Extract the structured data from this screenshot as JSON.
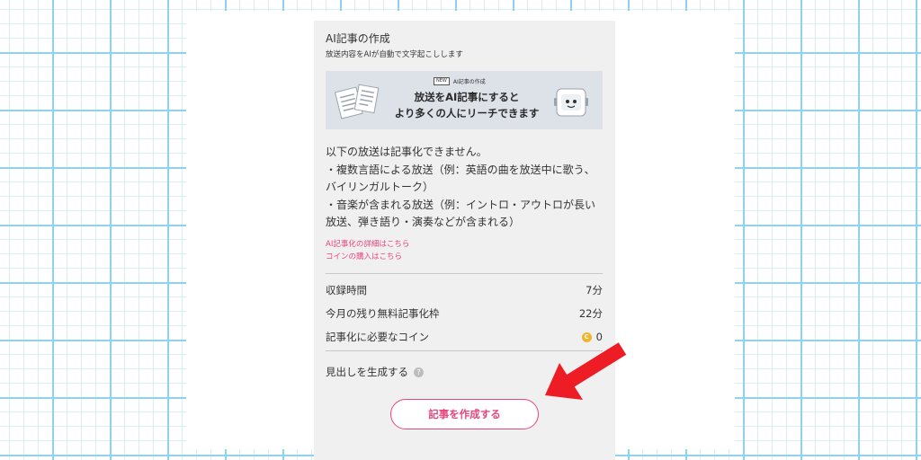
{
  "panel": {
    "title": "AI記事の作成",
    "subtitle": "放送内容をAIが自動で文字起こしします"
  },
  "banner": {
    "tag_new": "NEW",
    "tag_label": "AI記事の作成",
    "line1": "放送をAI記事にすると",
    "line2": "より多くの人にリーチできます"
  },
  "notice": {
    "lines": [
      "以下の放送は記事化できません。",
      "・複数言語による放送（例：英語の曲を放送中に歌う、",
      "バイリンガルトーク）",
      "・音楽が含まれる放送（例：イントロ・アウトロが長い",
      "放送、弾き語り・演奏などが含まれる）"
    ]
  },
  "links": {
    "details": "AI記事化の詳細はこちら",
    "buy_coins": "コインの購入はこちら"
  },
  "stats": {
    "recording_time": {
      "label": "収録時間",
      "value": "7分"
    },
    "free_remaining": {
      "label": "今月の残り無料記事化枠",
      "value": "22分"
    },
    "coins_needed": {
      "label": "記事化に必要なコイン",
      "value": "0",
      "icon": "coin-icon",
      "icon_glyph": "C"
    }
  },
  "headline": {
    "label": "見出しを生成する",
    "help_glyph": "?"
  },
  "create_button": {
    "label": "記事を作成する"
  },
  "colors": {
    "accent": "#e8467c",
    "arrow": "#ee1c25",
    "panel_bg": "#f0f0f0",
    "grid_line": "#8fd3ea"
  }
}
